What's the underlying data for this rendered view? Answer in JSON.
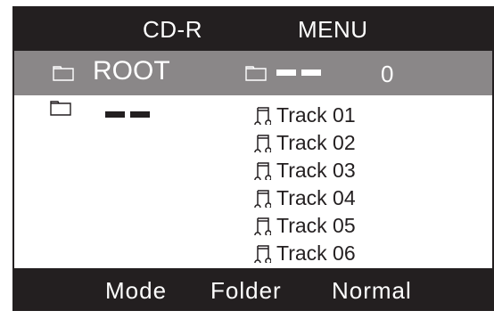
{
  "header": {
    "source": "CD-R",
    "title": "MENU"
  },
  "path_bar": {
    "root_label": "ROOT",
    "root_icon": "folder-icon",
    "current_folder_icon": "folder-icon",
    "current_folder_name": "– –",
    "file_count": "0"
  },
  "folders": [
    {
      "icon": "folder-icon",
      "name": "– –"
    }
  ],
  "tracks": [
    {
      "icon": "music-note-icon",
      "label": "Track 01"
    },
    {
      "icon": "music-note-icon",
      "label": "Track 02"
    },
    {
      "icon": "music-note-icon",
      "label": "Track 03"
    },
    {
      "icon": "music-note-icon",
      "label": "Track 04"
    },
    {
      "icon": "music-note-icon",
      "label": "Track 05"
    },
    {
      "icon": "music-note-icon",
      "label": "Track 06"
    }
  ],
  "status_bar": {
    "mode_label": "Mode",
    "folder_label": "Folder",
    "repeat_value": "Normal"
  },
  "colors": {
    "bar_dark": "#231f20",
    "bar_highlight": "#8a8788",
    "text_light": "#ffffff",
    "text_dark": "#231f20"
  }
}
